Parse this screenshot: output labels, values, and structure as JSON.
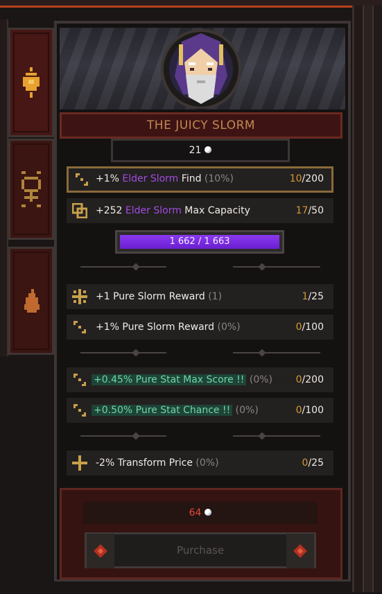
{
  "tabs": [
    {
      "icon": "flame-crest-icon",
      "active": true
    },
    {
      "icon": "feminine-rune-icon",
      "active": false
    },
    {
      "icon": "fire-icon",
      "active": false
    }
  ],
  "character": {
    "name": "THE JUICY SLORM",
    "portrait": "wizard-portrait"
  },
  "top_cost": {
    "value": "21",
    "icon": "slorm-gem-icon"
  },
  "upgrades": [
    {
      "icon": "scaling-arrows-icon",
      "prefix": "+1% ",
      "highlight": "Elder Slorm",
      "suffix": " Find",
      "note": "(10%)",
      "current": "10",
      "max": "/200"
    },
    {
      "icon": "overlapping-squares-icon",
      "prefix": "+252 ",
      "highlight": "Elder Slorm",
      "suffix": " Max Capacity",
      "note": "",
      "current": "17",
      "max": "/50"
    },
    {
      "icon": "cross-arrows-icon",
      "prefix": "+1 Pure Slorm Reward ",
      "highlight": "",
      "suffix": "",
      "note": "(1)",
      "current": "1",
      "max": "/25"
    },
    {
      "icon": "scaling-arrows-icon",
      "prefix": "+1% Pure Slorm Reward ",
      "highlight": "",
      "suffix": "",
      "note": "(0%)",
      "current": "0",
      "max": "/100"
    },
    {
      "icon": "scaling-arrows-icon",
      "prefix": "",
      "highlight": "+0.45% Pure Stat Max Score !!",
      "suffix": "",
      "note": "(0%)",
      "current": "0",
      "max": "/200"
    },
    {
      "icon": "scaling-arrows-icon",
      "prefix": "",
      "highlight": "+0.50% Pure Stat Chance !!",
      "suffix": "",
      "note": "(0%)",
      "current": "0",
      "max": "/100"
    },
    {
      "icon": "plus-cross-icon",
      "prefix": "-2% Transform Price ",
      "highlight": "",
      "suffix": "",
      "note": "(0%)",
      "current": "0",
      "max": "/25"
    }
  ],
  "capacity": {
    "label": "1 662 / 1 663",
    "fraction": 0.9994
  },
  "purchase": {
    "price": "64",
    "price_icon": "slorm-gem-icon",
    "button_label": "Purchase"
  },
  "colors": {
    "elder_slorm": "#a14de0",
    "pure_stat": "#6fd7a5",
    "price_red": "#e24a35",
    "count_orange": "#d29a35",
    "progress": "#7a2fe3"
  }
}
